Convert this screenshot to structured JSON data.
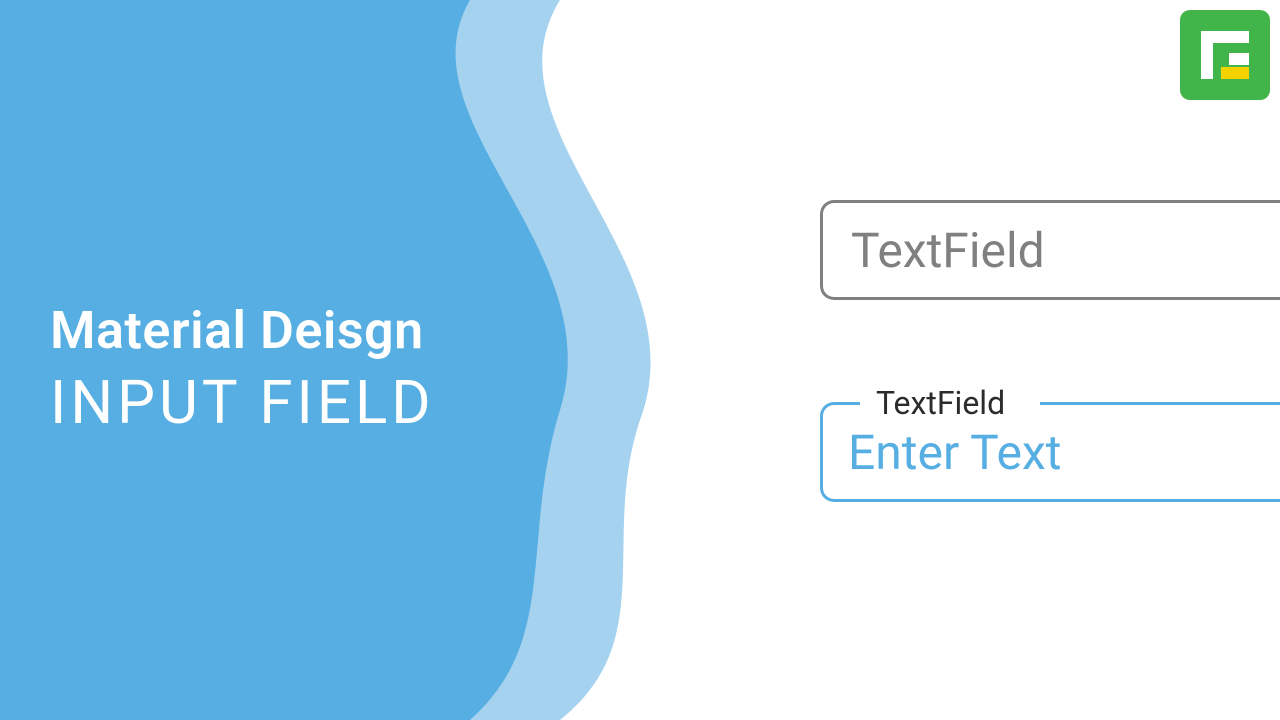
{
  "title": {
    "line1": "Material Deisgn",
    "line2": "INPUT FIELD"
  },
  "fields": {
    "idle": {
      "placeholder": "TextField"
    },
    "focused": {
      "label": "TextField",
      "value": "Enter Text"
    }
  },
  "colors": {
    "accent": "#56aee2",
    "waveDark": "#56aee2",
    "waveLight": "#a5d3ef",
    "idleBorder": "#808080",
    "logoBg": "#41b549",
    "logoAccent": "#f3d200"
  },
  "logo": {
    "name": "brand-logo"
  }
}
